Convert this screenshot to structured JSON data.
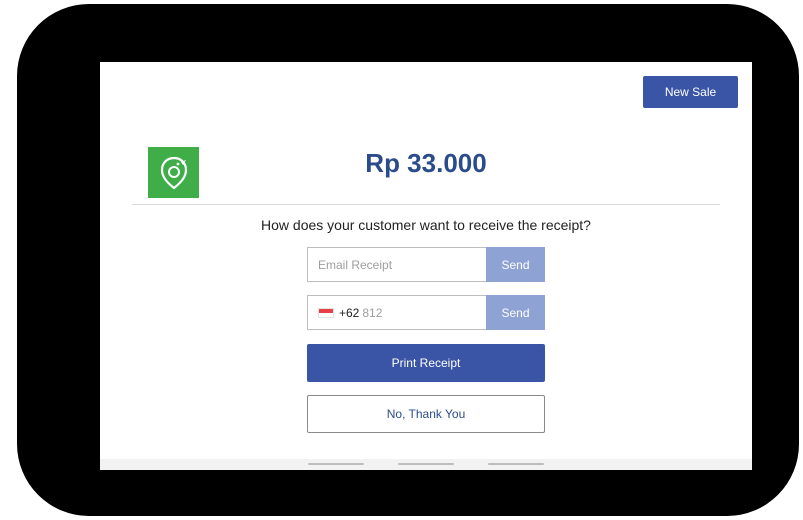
{
  "header": {
    "new_sale_label": "New Sale"
  },
  "brand": {
    "logo_icon": "bird-pin-icon",
    "logo_color": "#3fae49"
  },
  "receipt": {
    "amount": "Rp 33.000",
    "question": "How does your customer want to receive the receipt?",
    "email": {
      "placeholder": "Email Receipt",
      "send_label": "Send"
    },
    "phone": {
      "flag_icon": "indonesia-flag-icon",
      "country_code": "+62",
      "placeholder": "812",
      "send_label": "Send"
    },
    "print_label": "Print Receipt",
    "decline_label": "No, Thank You"
  },
  "colors": {
    "primary": "#3a55a5",
    "send_disabled": "#8ea2d4",
    "amount_text": "#2b4c8a"
  }
}
